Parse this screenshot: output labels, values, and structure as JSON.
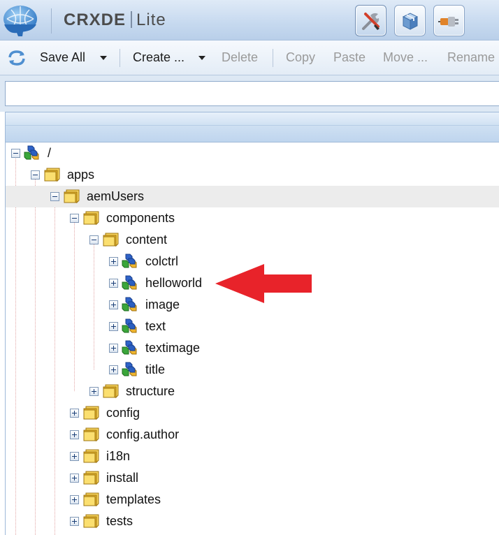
{
  "header": {
    "title_bold": "CRXDE",
    "title_light": "Lite",
    "buttons": [
      {
        "name": "develop-tools-icon",
        "active": true
      },
      {
        "name": "package-icon",
        "active": false
      },
      {
        "name": "plugin-icon",
        "active": false
      }
    ]
  },
  "toolbar": {
    "refresh_icon": "refresh-icon",
    "save_all": "Save All",
    "create": "Create ...",
    "delete": "Delete",
    "copy": "Copy",
    "paste": "Paste",
    "move": "Move ...",
    "rename": "Rename"
  },
  "address": {
    "value": "",
    "placeholder": ""
  },
  "tree": [
    {
      "label": "/",
      "depth": 0,
      "type": "node",
      "expanded": true
    },
    {
      "label": "apps",
      "depth": 1,
      "type": "folder",
      "expanded": true
    },
    {
      "label": "aemUsers",
      "depth": 2,
      "type": "folder",
      "expanded": true,
      "selected": true
    },
    {
      "label": "components",
      "depth": 3,
      "type": "folder",
      "expanded": true
    },
    {
      "label": "content",
      "depth": 4,
      "type": "folder",
      "expanded": true
    },
    {
      "label": "colctrl",
      "depth": 5,
      "type": "node",
      "expanded": false
    },
    {
      "label": "helloworld",
      "depth": 5,
      "type": "node",
      "expanded": false
    },
    {
      "label": "image",
      "depth": 5,
      "type": "node",
      "expanded": false
    },
    {
      "label": "text",
      "depth": 5,
      "type": "node",
      "expanded": false
    },
    {
      "label": "textimage",
      "depth": 5,
      "type": "node",
      "expanded": false
    },
    {
      "label": "title",
      "depth": 5,
      "type": "node",
      "expanded": false
    },
    {
      "label": "structure",
      "depth": 4,
      "type": "folder",
      "expanded": false
    },
    {
      "label": "config",
      "depth": 3,
      "type": "folder",
      "expanded": false
    },
    {
      "label": "config.author",
      "depth": 3,
      "type": "folder",
      "expanded": false
    },
    {
      "label": "i18n",
      "depth": 3,
      "type": "folder",
      "expanded": false
    },
    {
      "label": "install",
      "depth": 3,
      "type": "folder",
      "expanded": false
    },
    {
      "label": "templates",
      "depth": 3,
      "type": "folder",
      "expanded": false
    },
    {
      "label": "tests",
      "depth": 3,
      "type": "folder",
      "expanded": false
    }
  ],
  "annotation": {
    "icon": "red-arrow-icon",
    "color": "#e8232a",
    "points_to": "helloworld"
  },
  "colors": {
    "header_bg": "#c6d9ef",
    "toolbar_bg": "#eaf1f9",
    "selected_row": "#ececec",
    "folder": "#f3c53a",
    "arrow": "#e8232a"
  }
}
